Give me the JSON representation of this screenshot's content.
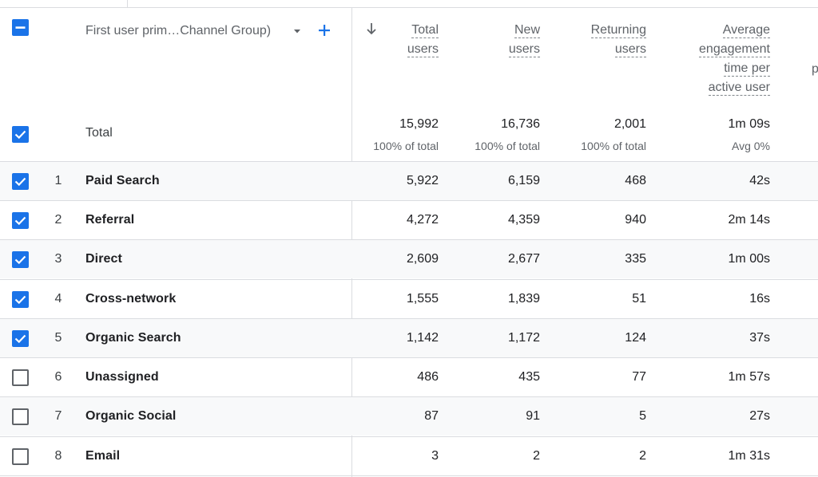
{
  "header": {
    "dimension_label": "First user prim…Channel Group)",
    "metrics": [
      {
        "lines": [
          "Total",
          "users"
        ]
      },
      {
        "lines": [
          "New",
          "users"
        ]
      },
      {
        "lines": [
          "Returning",
          "users"
        ]
      },
      {
        "lines": [
          "Average",
          "engagement",
          "time per",
          "active user"
        ]
      }
    ],
    "cut_column_fragment": "p"
  },
  "totals": {
    "label": "Total",
    "values": [
      "15,992",
      "16,736",
      "2,001",
      "1m 09s"
    ],
    "subtexts": [
      "100% of total",
      "100% of total",
      "100% of total",
      "Avg 0%"
    ]
  },
  "rows": [
    {
      "num": "1",
      "label": "Paid Search",
      "checked": true,
      "values": [
        "5,922",
        "6,159",
        "468",
        "42s"
      ]
    },
    {
      "num": "2",
      "label": "Referral",
      "checked": true,
      "values": [
        "4,272",
        "4,359",
        "940",
        "2m 14s"
      ]
    },
    {
      "num": "3",
      "label": "Direct",
      "checked": true,
      "values": [
        "2,609",
        "2,677",
        "335",
        "1m 00s"
      ]
    },
    {
      "num": "4",
      "label": "Cross-network",
      "checked": true,
      "values": [
        "1,555",
        "1,839",
        "51",
        "16s"
      ]
    },
    {
      "num": "5",
      "label": "Organic Search",
      "checked": true,
      "values": [
        "1,142",
        "1,172",
        "124",
        "37s"
      ]
    },
    {
      "num": "6",
      "label": "Unassigned",
      "checked": false,
      "values": [
        "486",
        "435",
        "77",
        "1m 57s"
      ]
    },
    {
      "num": "7",
      "label": "Organic Social",
      "checked": false,
      "values": [
        "87",
        "91",
        "5",
        "27s"
      ]
    },
    {
      "num": "8",
      "label": "Email",
      "checked": false,
      "values": [
        "3",
        "2",
        "2",
        "1m 31s"
      ]
    }
  ],
  "colors": {
    "accent": "#1a73e8",
    "row_alt": "#f8f9fa",
    "divider": "#dadce0"
  },
  "icons": {
    "select_all": "minus-checkbox-icon",
    "dropdown": "caret-down-icon",
    "add": "plus-icon",
    "sort": "arrow-down-icon"
  }
}
